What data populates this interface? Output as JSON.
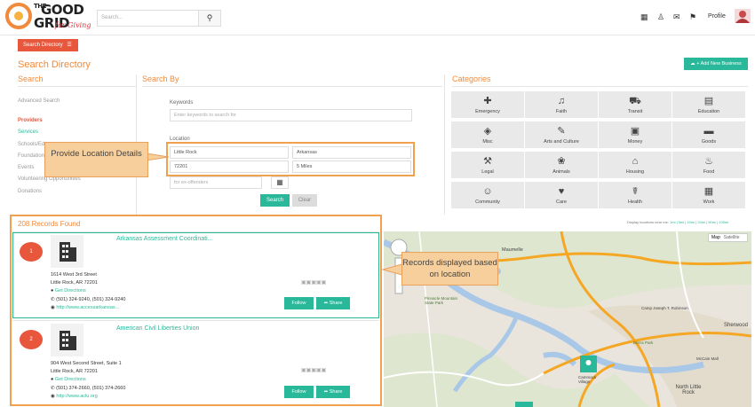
{
  "header": {
    "logo_the": "THE",
    "logo_good": "GOOD",
    "logo_grid": "GRID",
    "logo_tagline": "for Giving",
    "search_placeholder": "Search...",
    "profile_label": "Profile",
    "icons": [
      "grid-icon",
      "people-icon",
      "mail-icon",
      "bell-icon"
    ]
  },
  "toolbar": {
    "search_directory_button": "Search Directory",
    "page_title": "Search Directory",
    "add_business_button": "+ Add New Business"
  },
  "left_panel": {
    "title": "Search",
    "advanced_search": "Advanced Search",
    "items": [
      {
        "label": "Providers",
        "state": "active"
      },
      {
        "label": "Services",
        "state": "green"
      },
      {
        "label": "Schools/Edu",
        "state": "normal"
      },
      {
        "label": "Foundations",
        "state": "normal"
      },
      {
        "label": "Events",
        "state": "normal"
      },
      {
        "label": "Volunteering Opportunities",
        "state": "normal"
      },
      {
        "label": "Donations",
        "state": "normal"
      }
    ]
  },
  "search_by": {
    "title": "Search By",
    "keywords_label": "Keywords",
    "keywords_placeholder": "Enter keywords to search for",
    "location_label": "Location",
    "city": "Little Rock",
    "state": "Arkansas",
    "zip": "72201",
    "radius": "5 Miles",
    "offenders_placeholder": "for ex-offenders",
    "search_button": "Search",
    "clear_button": "Clear"
  },
  "categories": {
    "title": "Categories",
    "items": [
      {
        "label": "Emergency",
        "icon": "medkit-icon",
        "glyph": "✚"
      },
      {
        "label": "Faith",
        "icon": "bell-icon",
        "glyph": "♫"
      },
      {
        "label": "Transit",
        "icon": "car-icon",
        "glyph": "⛟"
      },
      {
        "label": "Education",
        "icon": "book-icon",
        "glyph": "▤"
      },
      {
        "label": "Misc",
        "icon": "cube-icon",
        "glyph": "◈"
      },
      {
        "label": "Arts and Culture",
        "icon": "brush-icon",
        "glyph": "✎"
      },
      {
        "label": "Money",
        "icon": "money-icon",
        "glyph": "▣"
      },
      {
        "label": "Goods",
        "icon": "tray-icon",
        "glyph": "▬"
      },
      {
        "label": "Legal",
        "icon": "gavel-icon",
        "glyph": "⚒"
      },
      {
        "label": "Animals",
        "icon": "paw-icon",
        "glyph": "❀"
      },
      {
        "label": "Housing",
        "icon": "home-icon",
        "glyph": "⌂"
      },
      {
        "label": "Food",
        "icon": "cutlery-icon",
        "glyph": "♨"
      },
      {
        "label": "Community",
        "icon": "users-icon",
        "glyph": "☺"
      },
      {
        "label": "Care",
        "icon": "heart-icon",
        "glyph": "♥"
      },
      {
        "label": "Health",
        "icon": "stethoscope-icon",
        "glyph": "☤"
      },
      {
        "label": "Work",
        "icon": "building-icon",
        "glyph": "▦"
      }
    ]
  },
  "results": {
    "count_text": "208 Records Found",
    "distance_prefix": "Display locations near me:",
    "distance_options": "1mi | 5mi | 10mi | 20mi | 50mi | 100mi",
    "records": [
      {
        "number": "1",
        "name": "Arkansas Assessment Coordinati...",
        "street": "1614 West 3rd Street",
        "city": "Little Rock, AR 72201",
        "directions": "Get Directions",
        "phone": "(501) 324-9240, (501) 324-9240",
        "website": "http://www.accessarkansas...",
        "follow": "Follow",
        "share": "Share"
      },
      {
        "number": "2",
        "name": "American Civil Liberties Union",
        "street": "904 West Second Street, Suite 1",
        "city": "Little Rock, AR 72201",
        "directions": "Get Directions",
        "phone": "(501) 374-2660, (501) 374-2660",
        "website": "http://www.aclu.org",
        "follow": "Follow",
        "share": "Share"
      }
    ]
  },
  "map": {
    "map_button": "Map",
    "satellite_button": "Satellite",
    "labels": {
      "maumelle": "Maumelle",
      "pinnacle": "Pinnacle Mountain State Park",
      "camp_joseph": "Camp Joseph T. Robinson",
      "sherwood": "Sherwood",
      "burns_park": "Burns Park",
      "mccain": "McCain Mall",
      "cammack": "Cammack Village",
      "north_lr": "North Little Rock"
    }
  },
  "annotations": {
    "location_callout": "Provide Location Details",
    "records_callout": "Records displayed based on location"
  },
  "colors": {
    "accent_orange": "#f08a3c",
    "brand_red": "#e8563b",
    "green": "#29b99a"
  }
}
